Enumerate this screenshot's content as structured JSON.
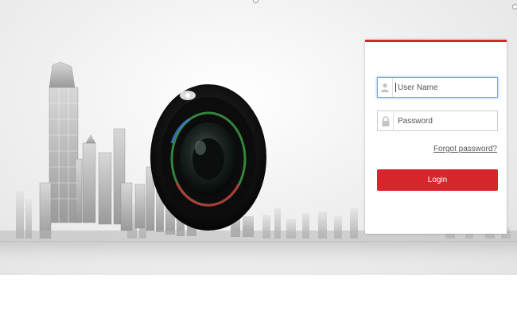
{
  "login": {
    "username_placeholder": "User Name",
    "password_placeholder": "Password",
    "forgot_label": "Forgot password?",
    "login_label": "Login"
  },
  "colors": {
    "accent": "#d6252b",
    "focus_border": "#7fa8d9",
    "background": "#ffffff"
  },
  "icons": {
    "username": "user-icon",
    "password": "lock-icon"
  }
}
